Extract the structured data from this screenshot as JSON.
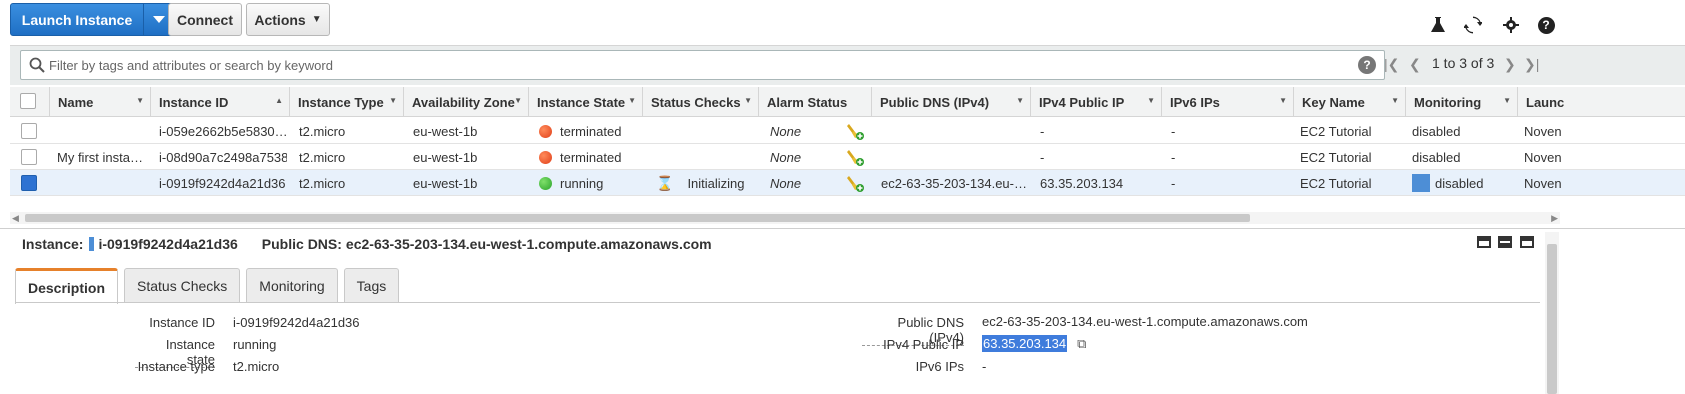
{
  "toolbar": {
    "launch_label": "Launch Instance",
    "connect_label": "Connect",
    "actions_label": "Actions"
  },
  "filter": {
    "placeholder": "Filter by tags and attributes or search by keyword",
    "pager_text": "1 to 3 of 3"
  },
  "columns": [
    "Name",
    "Instance ID",
    "Instance Type",
    "Availability Zone",
    "Instance State",
    "Status Checks",
    "Alarm Status",
    "Public DNS (IPv4)",
    "IPv4 Public IP",
    "IPv6 IPs",
    "Key Name",
    "Monitoring",
    "Launc"
  ],
  "rows": [
    {
      "name": "",
      "id": "i-059e2662b5e5830…",
      "type": "t2.micro",
      "az": "eu-west-1b",
      "state": "terminated",
      "state_color": "red",
      "status": "",
      "alarm": "None",
      "dns": "",
      "ipv4": "-",
      "ipv6": "-",
      "key": "EC2 Tutorial",
      "monitoring": "disabled",
      "launch": "Noven"
    },
    {
      "name": "My first insta…",
      "id": "i-08d90a7c2498a7538",
      "type": "t2.micro",
      "az": "eu-west-1b",
      "state": "terminated",
      "state_color": "red",
      "status": "",
      "alarm": "None",
      "dns": "",
      "ipv4": "-",
      "ipv6": "-",
      "key": "EC2 Tutorial",
      "monitoring": "disabled",
      "launch": "Noven"
    },
    {
      "name": "",
      "id": "i-0919f9242d4a21d36",
      "type": "t2.micro",
      "az": "eu-west-1b",
      "state": "running",
      "state_color": "green",
      "status": "Initializing",
      "alarm": "None",
      "dns": "ec2-63-35-203-134.eu-…",
      "ipv4": "63.35.203.134",
      "ipv6": "-",
      "key": "EC2 Tutorial",
      "monitoring": "disabled",
      "launch": "Noven"
    }
  ],
  "detail": {
    "instance_label": "Instance:",
    "instance_id": "i-0919f9242d4a21d36",
    "dns_label": "Public DNS:",
    "dns_value": "ec2-63-35-203-134.eu-west-1.compute.amazonaws.com",
    "tabs": [
      "Description",
      "Status Checks",
      "Monitoring",
      "Tags"
    ],
    "left_fields": [
      {
        "label": "Instance ID",
        "value": "i-0919f9242d4a21d36"
      },
      {
        "label": "Instance state",
        "value": "running"
      },
      {
        "label": "Instance type",
        "value": "t2.micro"
      }
    ],
    "right_fields": [
      {
        "label": "Public DNS (IPv4)",
        "value": "ec2-63-35-203-134.eu-west-1.compute.amazonaws.com"
      },
      {
        "label": "IPv4 Public IP",
        "value": "63.35.203.134"
      },
      {
        "label": "IPv6 IPs",
        "value": "-"
      }
    ]
  },
  "colors": {
    "accent": "#1f6fc4",
    "tab_accent": "#e6812b",
    "selected_row": "#e8f1fb"
  }
}
